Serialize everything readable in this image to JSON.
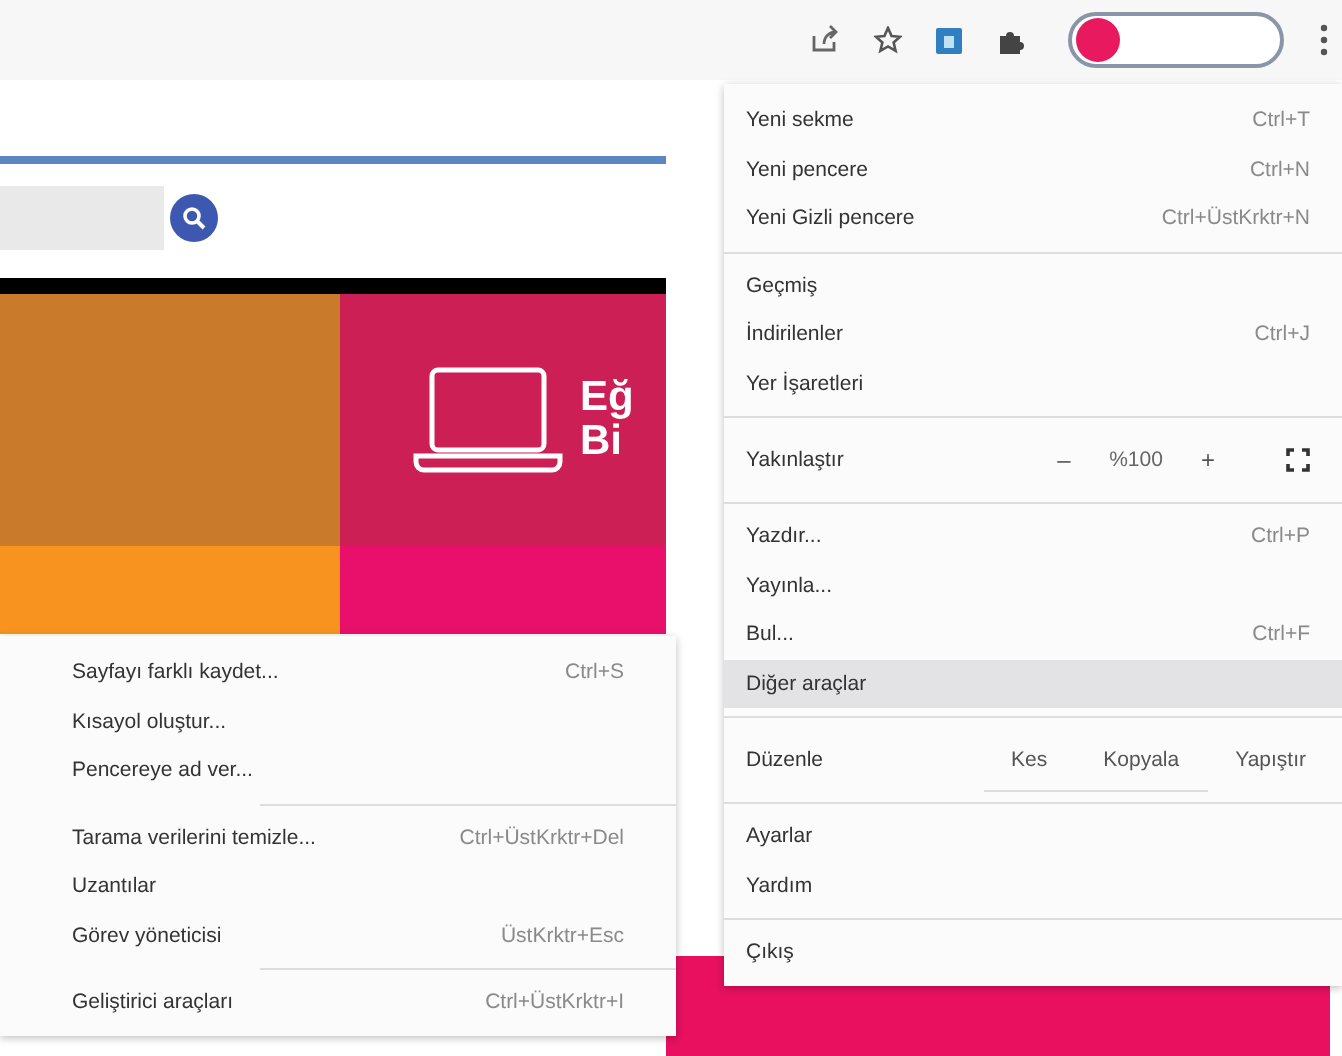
{
  "tile": {
    "lines": [
      "Eğ",
      "Bi"
    ]
  },
  "main_menu": {
    "items": [
      {
        "kind": "item",
        "label": "Yeni sekme",
        "shortcut": "Ctrl+T",
        "selected": false
      },
      {
        "kind": "item",
        "label": "Yeni pencere",
        "shortcut": "Ctrl+N",
        "selected": false
      },
      {
        "kind": "item",
        "label": "Yeni Gizli pencere",
        "shortcut": "Ctrl+ÜstKrktr+N",
        "selected": false
      },
      {
        "kind": "separator"
      },
      {
        "kind": "item",
        "label": "Geçmiş",
        "selected": false
      },
      {
        "kind": "item",
        "label": "İndirilenler",
        "shortcut": "Ctrl+J",
        "selected": false
      },
      {
        "kind": "item",
        "label": "Yer İşaretleri",
        "selected": false
      },
      {
        "kind": "separator"
      },
      {
        "kind": "zoom",
        "label": "Yakınlaştır",
        "minus": "–",
        "value": "%100",
        "plus": "+"
      },
      {
        "kind": "separator"
      },
      {
        "kind": "item",
        "label": "Yazdır...",
        "shortcut": "Ctrl+P",
        "selected": false
      },
      {
        "kind": "item",
        "label": "Yayınla...",
        "selected": false
      },
      {
        "kind": "item",
        "label": "Bul...",
        "shortcut": "Ctrl+F",
        "selected": false
      },
      {
        "kind": "item",
        "label": "Diğer araçlar",
        "selected": true
      },
      {
        "kind": "separator"
      },
      {
        "kind": "edit",
        "label": "Düzenle",
        "buttons": [
          "Kes",
          "Kopyala",
          "Yapıştır"
        ]
      },
      {
        "kind": "separator"
      },
      {
        "kind": "item",
        "label": "Ayarlar",
        "selected": false
      },
      {
        "kind": "item",
        "label": "Yardım",
        "selected": false
      },
      {
        "kind": "separator"
      },
      {
        "kind": "item",
        "label": "Çıkış",
        "selected": false
      }
    ]
  },
  "sub_menu": {
    "items": [
      {
        "kind": "item",
        "label": "Sayfayı farklı kaydet...",
        "shortcut": "Ctrl+S",
        "selected": false
      },
      {
        "kind": "item",
        "label": "Kısayol oluştur...",
        "selected": false
      },
      {
        "kind": "item",
        "label": "Pencereye ad ver...",
        "selected": false
      },
      {
        "kind": "separator"
      },
      {
        "kind": "item",
        "label": "Tarama verilerini temizle...",
        "shortcut": "Ctrl+ÜstKrktr+Del",
        "selected": false
      },
      {
        "kind": "item",
        "label": "Uzantılar",
        "selected": false
      },
      {
        "kind": "item",
        "label": "Görev yöneticisi",
        "shortcut": "ÜstKrktr+Esc",
        "selected": false
      },
      {
        "kind": "separator"
      },
      {
        "kind": "item",
        "label": "Geliştirici araçları",
        "shortcut": "Ctrl+ÜstKrktr+I",
        "selected": false
      }
    ]
  }
}
